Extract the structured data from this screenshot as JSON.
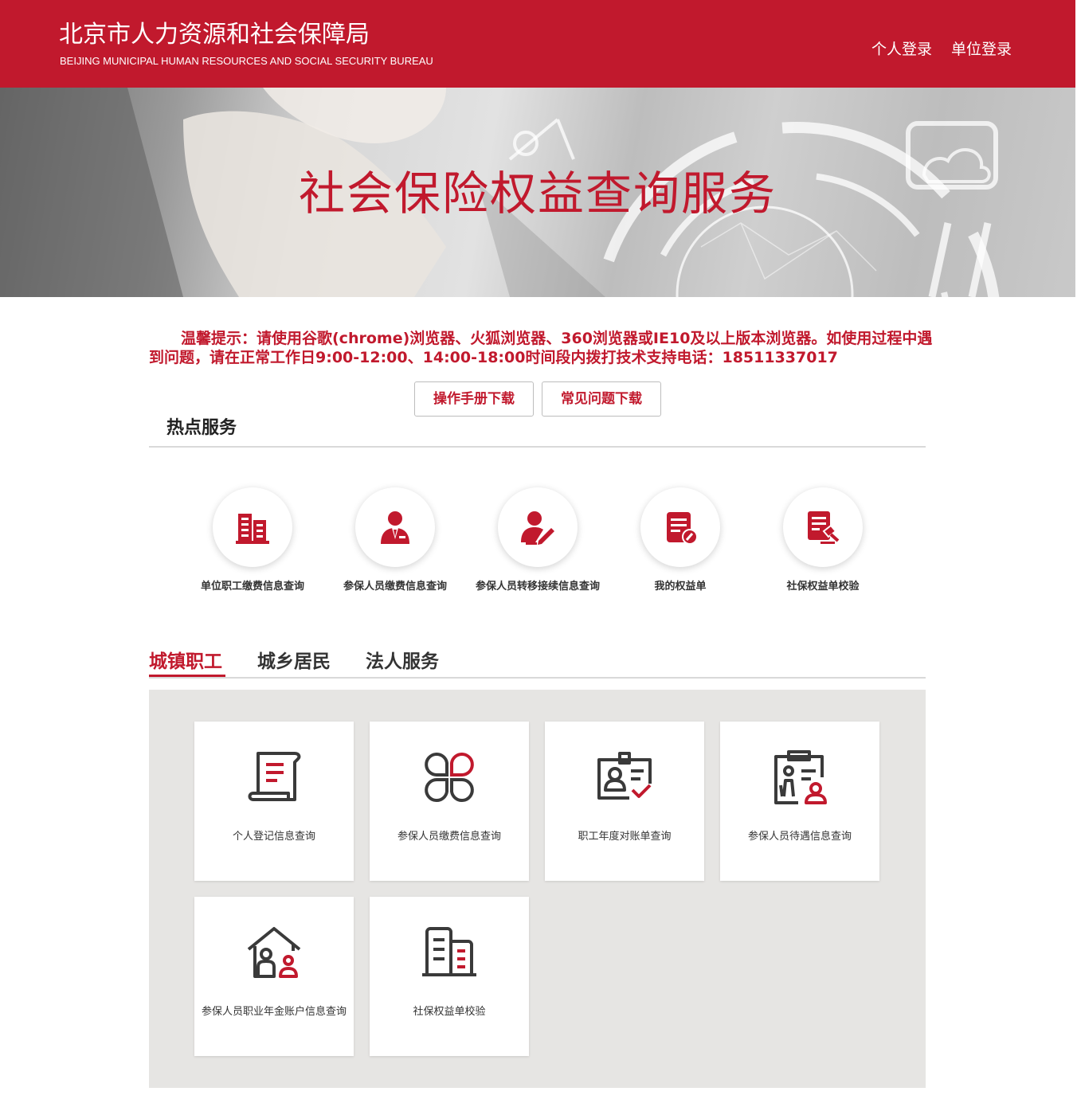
{
  "header": {
    "title_cn": "北京市人力资源和社会保障局",
    "title_en": "BEIJING MUNICIPAL HUMAN RESOURCES AND SOCIAL SECURITY BUREAU",
    "personal_login": "个人登录",
    "unit_login": "单位登录"
  },
  "banner": {
    "title": "社会保险权益查询服务"
  },
  "notice": {
    "text": "温馨提示：请使用谷歌(chrome)浏览器、火狐浏览器、360浏览器或IE10及以上版本浏览器。如使用过程中遇到问题，请在正常工作日9:00-12:00、14:00-18:00时间段内拨打技术支持电话：18511337017"
  },
  "downloads": {
    "manual": "操作手册下载",
    "faq": "常见问题下载"
  },
  "hot_services": {
    "title": "热点服务",
    "items": [
      {
        "label": "单位职工缴费信息查询",
        "icon": "building-icon"
      },
      {
        "label": "参保人员缴费信息查询",
        "icon": "person-tie-icon"
      },
      {
        "label": "参保人员转移接续信息查询",
        "icon": "person-edit-icon"
      },
      {
        "label": "我的权益单",
        "icon": "document-edit-icon"
      },
      {
        "label": "社保权益单校验",
        "icon": "document-gavel-icon"
      }
    ]
  },
  "tabs": [
    {
      "label": "城镇职工",
      "active": true
    },
    {
      "label": "城乡居民",
      "active": false
    },
    {
      "label": "法人服务",
      "active": false
    }
  ],
  "services": [
    {
      "label": "个人登记信息查询",
      "icon": "scroll-document-icon"
    },
    {
      "label": "参保人员缴费信息查询",
      "icon": "clover-icon"
    },
    {
      "label": "职工年度对账单查询",
      "icon": "id-card-check-icon"
    },
    {
      "label": "参保人员待遇信息查询",
      "icon": "clipboard-elderly-icon"
    },
    {
      "label": "参保人员职业年金账户信息查询",
      "icon": "house-people-icon"
    },
    {
      "label": "社保权益单校验",
      "icon": "buildings-icon"
    }
  ],
  "colors": {
    "brand_red": "#c1192d",
    "panel_gray": "#e6e5e3",
    "icon_dark": "#3a3a3a"
  }
}
